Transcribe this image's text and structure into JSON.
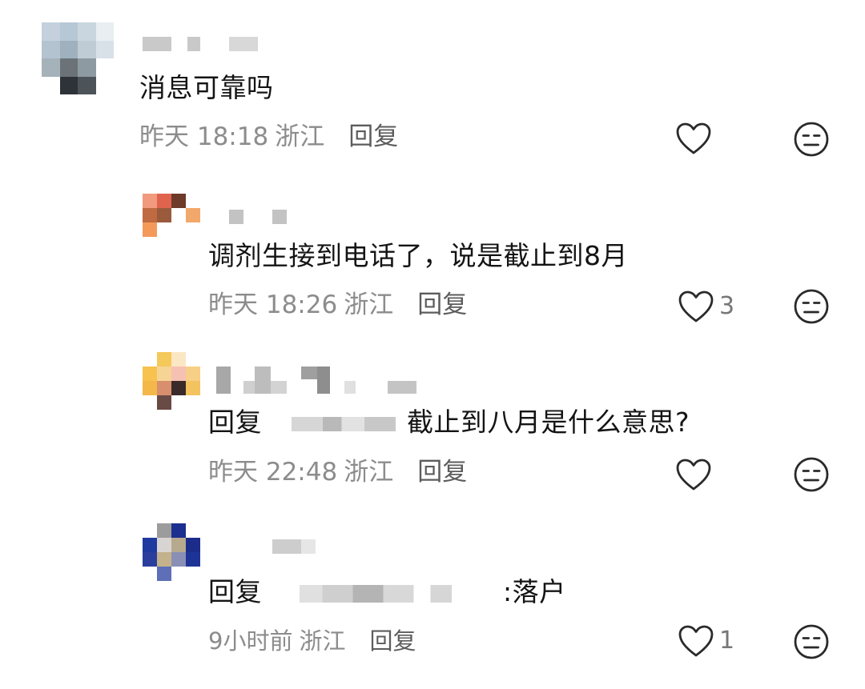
{
  "comments": [
    {
      "text": "消息可靠吗",
      "time": "昨天 18:18",
      "location": "浙江",
      "reply_label": "回复",
      "like_count": ""
    },
    {
      "text": "调剂生接到电话了，说是截止到8月",
      "time": "昨天 18:26",
      "location": "浙江",
      "reply_label": "回复",
      "like_count": "3"
    },
    {
      "reply_prefix": "回复",
      "text": "截止到八月是什么意思?",
      "time": "昨天 22:48",
      "location": "浙江",
      "reply_label": "回复",
      "like_count": ""
    },
    {
      "reply_prefix": "回复",
      "text": ":落户",
      "time": "9小时前",
      "location": "浙江",
      "reply_label": "回复",
      "like_count": "1"
    }
  ],
  "icons": {
    "like": "heart-outline-icon",
    "dislike": "meh-face-icon"
  },
  "colors": {
    "primary_text": "#141414",
    "meta_text": "#8c8c8c",
    "icon_stroke": "#2a2a2a"
  }
}
